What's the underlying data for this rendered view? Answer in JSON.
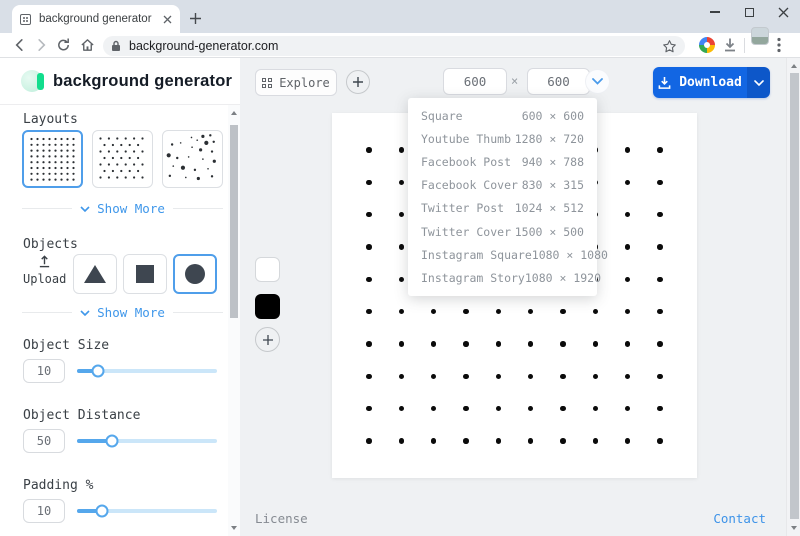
{
  "browser": {
    "tab_title": "background generator",
    "url": "background-generator.com"
  },
  "header": {
    "logo_text": "background generator",
    "explore_label": "Explore",
    "size": {
      "width": "600",
      "height": "600",
      "separator": "×"
    },
    "download_label": "Download"
  },
  "presets": [
    {
      "label": "Square",
      "size": "600 × 600"
    },
    {
      "label": "Youtube Thumb",
      "size": "1280 × 720"
    },
    {
      "label": "Facebook Post",
      "size": "940 × 788"
    },
    {
      "label": "Facebook Cover",
      "size": "830 × 315"
    },
    {
      "label": "Twitter Post",
      "size": "1024 × 512"
    },
    {
      "label": "Twitter Cover",
      "size": "1500 × 500"
    },
    {
      "label": "Instagram Square",
      "size": "1080 × 1080"
    },
    {
      "label": "Instagram Story",
      "size": "1080 × 1920"
    }
  ],
  "sidebar": {
    "layouts": {
      "title": "Layouts",
      "show_more": "Show More",
      "options": [
        {
          "name": "grid",
          "selected": true
        },
        {
          "name": "staggered",
          "selected": false
        },
        {
          "name": "random",
          "selected": false
        }
      ]
    },
    "objects": {
      "title": "Objects",
      "upload_label": "Upload",
      "show_more": "Show More",
      "shapes": [
        {
          "name": "triangle",
          "selected": false
        },
        {
          "name": "square",
          "selected": false
        },
        {
          "name": "circle",
          "selected": true
        }
      ]
    },
    "sliders": [
      {
        "label": "Object Size",
        "value": "10",
        "percent": 15
      },
      {
        "label": "Object Distance",
        "value": "50",
        "percent": 25
      },
      {
        "label": "Padding %",
        "value": "10",
        "percent": 18
      }
    ]
  },
  "canvas": {
    "rows": 10,
    "cols": 10,
    "padding": 37,
    "dot_size": 5.5,
    "dot_color": "#0b0b0b",
    "background": "#ffffff"
  },
  "swatches": [
    {
      "name": "white",
      "color": "#ffffff"
    },
    {
      "name": "black",
      "color": "#000000"
    }
  ],
  "footer": {
    "license": "License",
    "contact": "Contact"
  },
  "colors": {
    "accent": "#3f97ea",
    "download_blue": "#1266e3",
    "download_dark": "#0d57c9",
    "slider_fill": "#55a7ec",
    "slider_track": "#cbe6f9"
  }
}
